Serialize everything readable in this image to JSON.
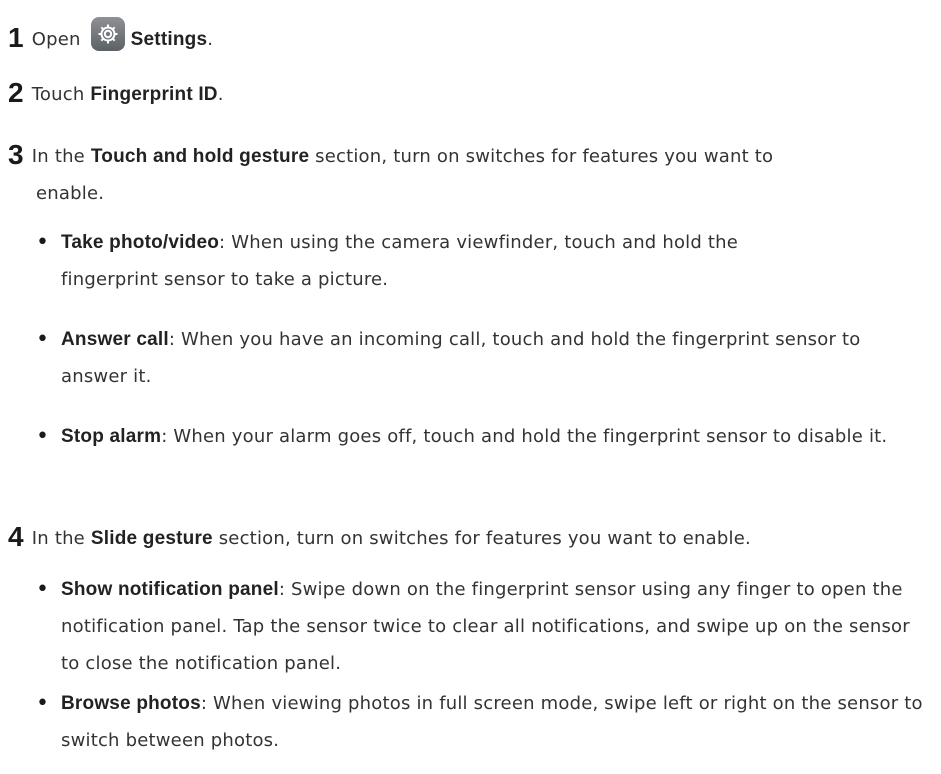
{
  "steps": [
    {
      "number": "1",
      "parts": [
        "Open",
        "Settings",
        "."
      ]
    },
    {
      "number": "2",
      "parts": [
        "Touch ",
        "Fingerprint ID",
        "."
      ]
    },
    {
      "number": "3",
      "parts": [
        "In the ",
        "Touch and hold gesture",
        " section, turn on switches for features you want to enable."
      ],
      "bullets": [
        {
          "term": "Take photo/video",
          "text": ": When using the camera viewfinder, touch and hold the fingerprint sensor to take a picture."
        },
        {
          "term": "Answer call",
          "text": ": When you have an incoming call, touch and hold the fingerprint sensor to answer it."
        },
        {
          "term": "Stop alarm",
          "text": ": When your alarm goes off, touch and hold the fingerprint sensor to disable it."
        }
      ]
    },
    {
      "number": "4",
      "parts": [
        "In the ",
        "Slide gesture",
        " section, turn on switches for features you want to enable."
      ],
      "bullets": [
        {
          "term": "Show notification panel",
          "text": ": Swipe down on the fingerprint sensor using any finger to open the notification panel. Tap the sensor twice to clear all notifications, and swipe up on the sensor to close the notification panel."
        },
        {
          "term": "Browse photos",
          "text": ": When viewing photos in full screen mode, swipe left or right on the sensor to switch between photos."
        }
      ]
    }
  ],
  "icons": {
    "settings": "gear-icon",
    "settings_icon_color": "#70757a"
  }
}
